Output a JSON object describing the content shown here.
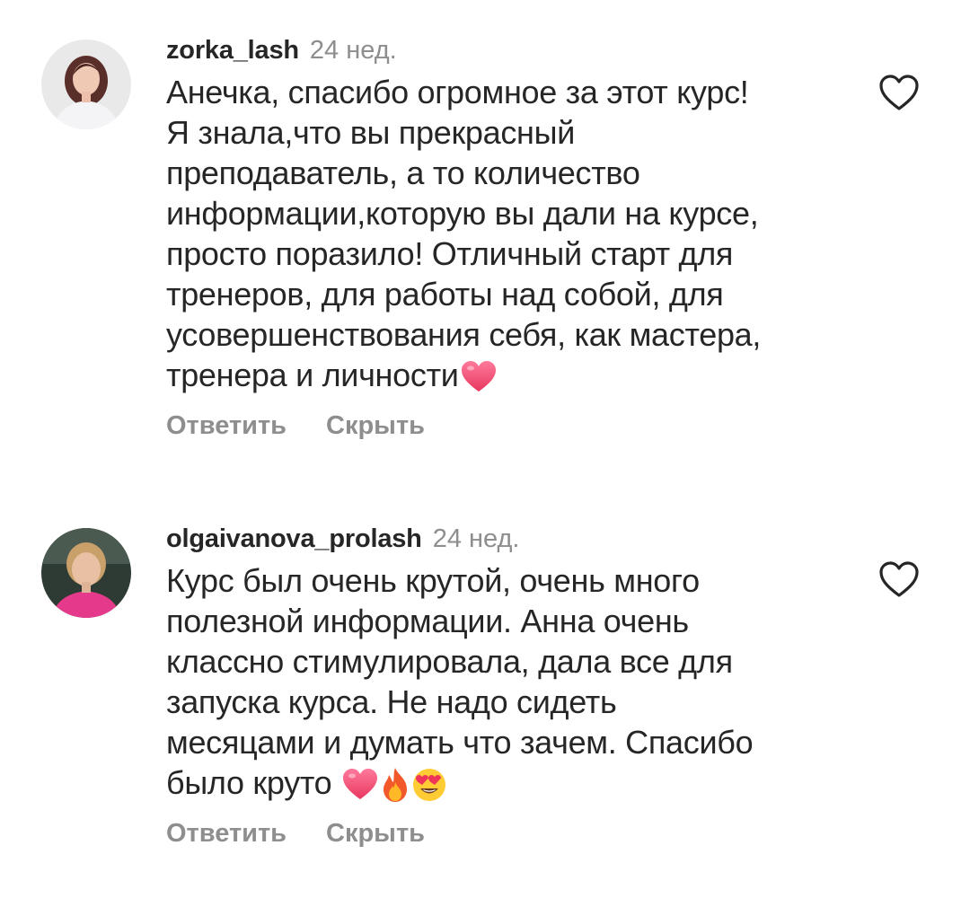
{
  "comments": [
    {
      "username": "zorka_lash",
      "time": "24 нед.",
      "text": "Анечка, спасибо огромное за этот курс!\nЯ знала,что вы прекрасный\nпреподаватель, а то количество\nинформации,которую вы дали на курсе,\nпросто поразило! Отличный старт для\nтренеров, для работы над собой, для\nусовершенствования себя, как мастера,\nтренера и личности",
      "emojis": [
        "pink-heart-icon"
      ],
      "reply_label": "Ответить",
      "hide_label": "Скрыть"
    },
    {
      "username": "olgaivanova_prolash",
      "time": "24 нед.",
      "text": "Курс был очень крутой, очень много\nполезной информации. Анна очень\nклассно стимулировала, дала все для\nзапуска курса. Не надо сидеть\nмесяцами и думать что зачем. Спасибо\nбыло круто ",
      "emojis": [
        "pink-heart-icon",
        "fire-icon",
        "heart-eyes-icon"
      ],
      "reply_label": "Ответить",
      "hide_label": "Скрыть"
    }
  ],
  "colors": {
    "text": "#262626",
    "secondary": "#8e8e8e",
    "heart_pink": "#f0507a"
  }
}
